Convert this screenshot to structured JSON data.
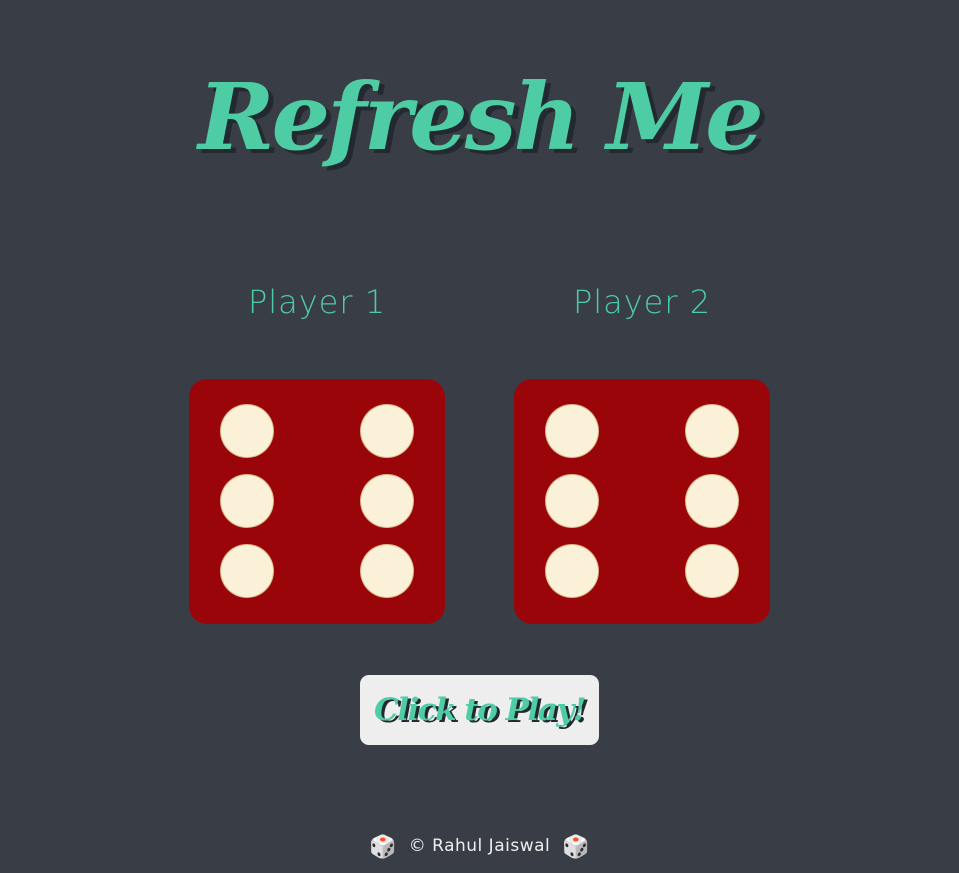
{
  "header": {
    "title": "Refresh Me"
  },
  "players": [
    {
      "label": "Player 1",
      "die_value": 6
    },
    {
      "label": "Player 2",
      "die_value": 6
    }
  ],
  "play_button": {
    "label": "Click to Play!"
  },
  "footer": {
    "text": "© Rahul Jaiswal",
    "icon_left": "🎲",
    "icon_right": "🎲"
  },
  "colors": {
    "background": "#393e46",
    "accent": "#4ecca3",
    "die": "#9a0509",
    "pip": "#fbf1d8",
    "button": "#eeeeee"
  }
}
